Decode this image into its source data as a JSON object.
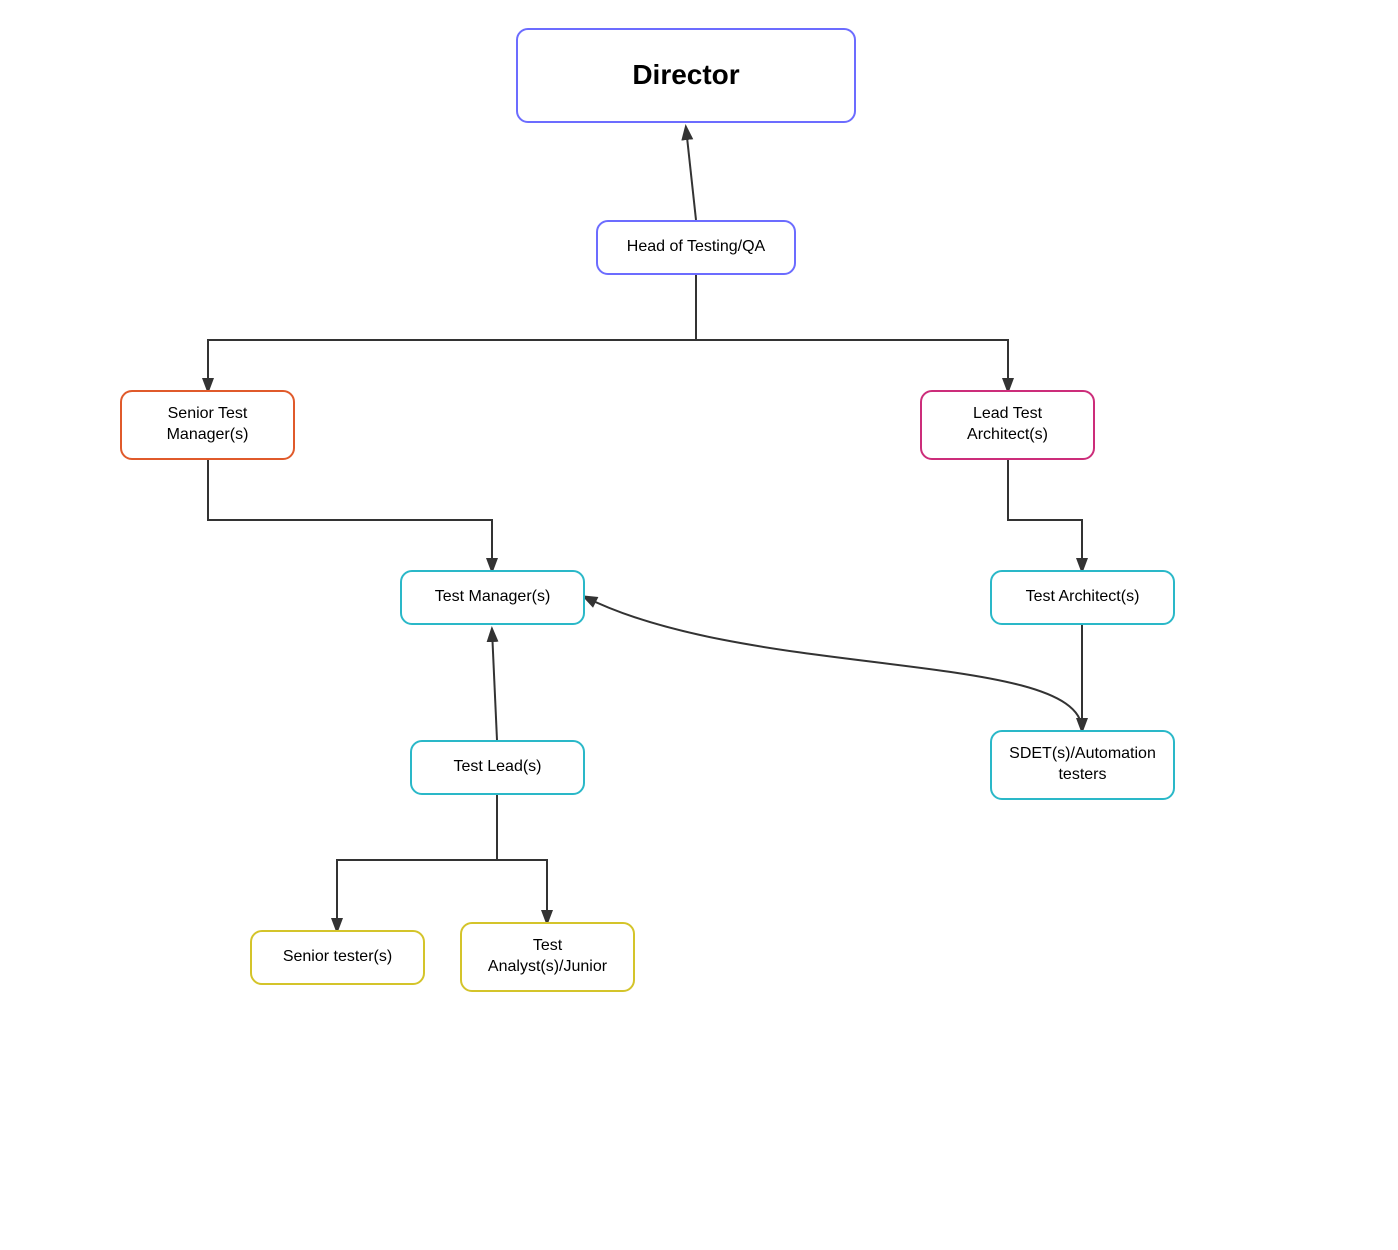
{
  "nodes": {
    "director": {
      "label": "Director"
    },
    "head_qa": {
      "label": "Head of Testing/QA"
    },
    "senior_test_manager": {
      "label": "Senior Test Manager(s)"
    },
    "lead_test_architect": {
      "label": "Lead Test Architect(s)"
    },
    "test_manager": {
      "label": "Test Manager(s)"
    },
    "test_architect": {
      "label": "Test Architect(s)"
    },
    "test_lead": {
      "label": "Test Lead(s)"
    },
    "sdet": {
      "label": "SDET(s)/Automation testers"
    },
    "senior_tester": {
      "label": "Senior tester(s)"
    },
    "test_analyst": {
      "label": "Test Analyst(s)/Junior"
    }
  }
}
